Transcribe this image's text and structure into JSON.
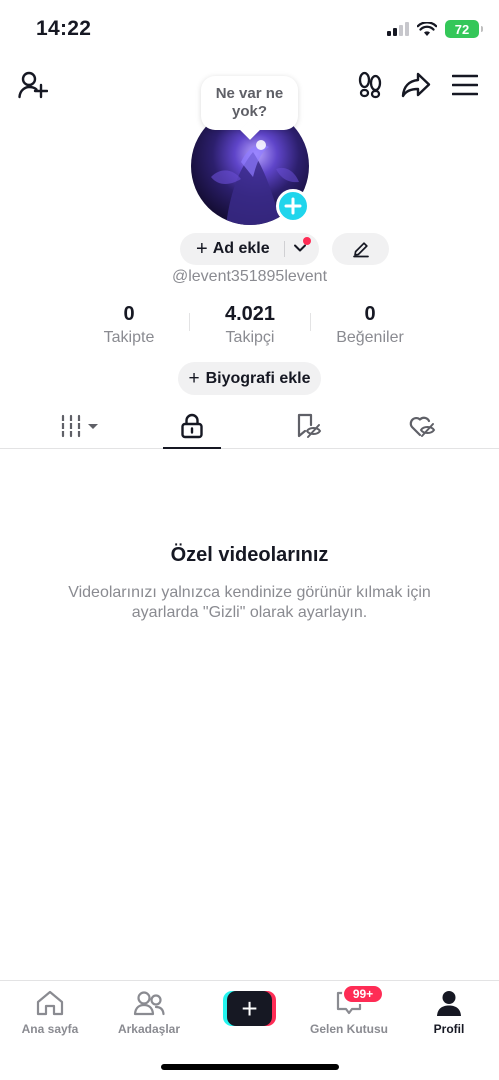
{
  "status_bar": {
    "time": "14:22",
    "battery": "72"
  },
  "top_bar": {
    "icons": [
      "add-friend-icon",
      "footprint-icon",
      "share-icon",
      "menu-icon"
    ]
  },
  "profile": {
    "note_bubble": "Ne var ne yok?",
    "add_name_label": "Ad ekle",
    "username": "@levent351895levent",
    "stats": {
      "following_value": "0",
      "following_label": "Takipte",
      "followers_value": "4.021",
      "followers_label": "Takipçi",
      "likes_value": "0",
      "likes_label": "Beğeniler"
    },
    "add_bio_label": "Biyografi ekle"
  },
  "tabs": [
    {
      "name": "videos",
      "icon": "grid-icon",
      "active": false
    },
    {
      "name": "private",
      "icon": "lock-icon",
      "active": true
    },
    {
      "name": "saved",
      "icon": "bookmark-hidden-icon",
      "active": false
    },
    {
      "name": "liked",
      "icon": "heart-hidden-icon",
      "active": false
    }
  ],
  "empty_state": {
    "title": "Özel videolarınız",
    "description": "Videolarınızı yalnızca kendinize görünür kılmak için ayarlarda \"Gizli\" olarak ayarlayın."
  },
  "bottom_nav": {
    "home": "Ana sayfa",
    "friends": "Arkadaşlar",
    "inbox": "Gelen Kutusu",
    "inbox_badge": "99+",
    "profile": "Profil"
  },
  "colors": {
    "accent_cyan": "#20d5ec",
    "accent_red": "#fe2c55",
    "text_primary": "#161823",
    "text_secondary": "#8a8b91"
  }
}
